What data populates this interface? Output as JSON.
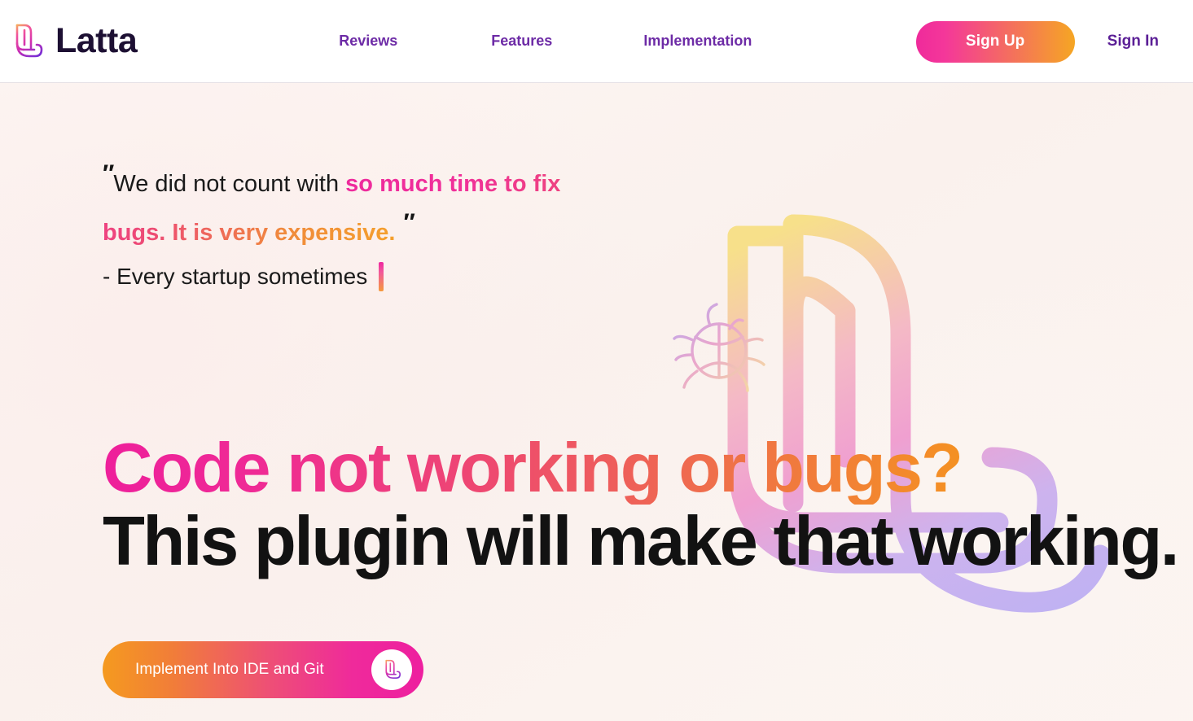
{
  "header": {
    "brand_name": "Latta",
    "brand_logo_icon": "latta-leaf-logo-icon",
    "nav": [
      {
        "label": "Reviews"
      },
      {
        "label": "Features"
      },
      {
        "label": "Implementation"
      }
    ],
    "sign_up_label": "Sign Up",
    "sign_in_label": "Sign In",
    "colors": {
      "brand_text": "#1d1033",
      "nav_link": "#6d2ba6",
      "sign_in": "#5b1f96",
      "signup_gradient_from": "#ef2a9b",
      "signup_gradient_to": "#f5a623",
      "header_bg": "#ffffff",
      "header_border": "#e6e1e6"
    }
  },
  "hero": {
    "background_color": "#faf1ed",
    "quote": {
      "open_mark": "″",
      "close_mark": "″",
      "plain_prefix": "We did not count with ",
      "emphasis": "so much time to fix bugs. It is very expensive.",
      "author": "- Every startup sometimes",
      "caret_icon": "text-cursor-caret-icon",
      "emphasis_gradient_from": "#ee2a9c",
      "emphasis_gradient_to": "#f4a02c",
      "plain_color": "#1a1a1a"
    },
    "headline": {
      "line1": "Code not working or bugs?",
      "line2": "This plugin will make that working.",
      "line1_gradient_from": "#ee1f9b",
      "line1_gradient_to": "#f7a118",
      "line2_color": "#121212"
    },
    "cta": {
      "label": "Implement Into IDE and Git",
      "badge_icon": "latta-leaf-logo-icon",
      "gradient_from": "#f59a1f",
      "gradient_to": "#ee1f9f",
      "text_color": "#ffffff"
    },
    "artwork": {
      "leaf_icon": "large-leaf-outline-icon",
      "bug_icon": "bug-outline-icon",
      "leaf_gradient_top": "#f7e08a",
      "leaf_gradient_mid": "#f0a0c8",
      "leaf_gradient_bottom": "#c4b5f0"
    }
  }
}
